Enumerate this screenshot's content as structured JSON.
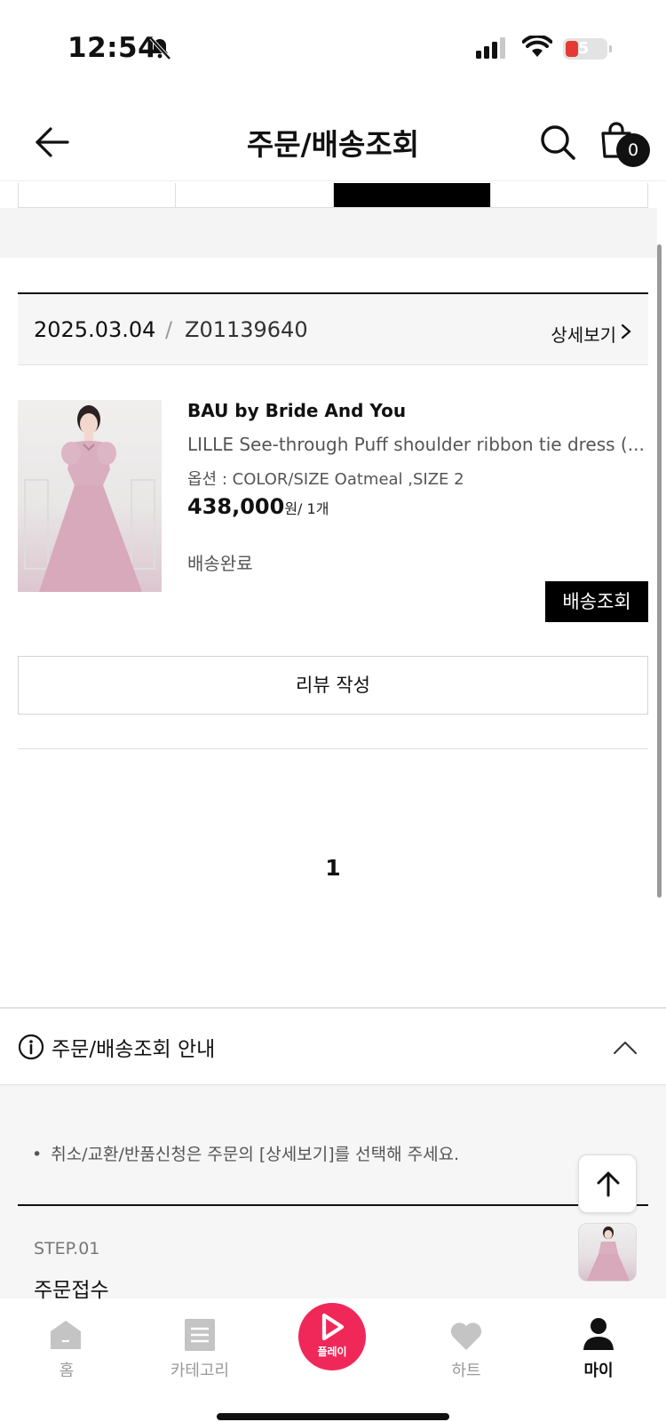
{
  "status_bar": {
    "time": "12:54",
    "battery": "5",
    "icons": [
      "bell-muted-icon",
      "signal-icon",
      "wifi-icon",
      "battery-icon"
    ]
  },
  "header": {
    "title": "주문/배송조회",
    "cart_count": "0",
    "icons": [
      "back-arrow-icon",
      "search-icon",
      "shopping-bag-icon"
    ]
  },
  "order": {
    "date": "2025.03.04",
    "separator": "/",
    "order_number": "Z01139640",
    "detail_label": "상세보기",
    "item": {
      "brand": "BAU by Bride And You",
      "name": "LILLE See-through Puff shoulder ribbon tie dress (...",
      "option": "옵션 : COLOR/SIZE Oatmeal ,SIZE 2",
      "price": "438,000",
      "price_unit": "원/ 1개",
      "status": "배송완료",
      "track_button": "배송조회"
    },
    "review_button": "리뷰 작성"
  },
  "pagination": {
    "current": "1"
  },
  "guide": {
    "title": "주문/배송조회 안내",
    "notice": "취소/교환/반품신청은 주문의 [상세보기]를 선택해 주세요.",
    "step_label": "STEP.01",
    "step_name": "주문접수"
  },
  "bottom_nav": {
    "home": "홈",
    "category": "카테고리",
    "play": "플레이",
    "heart": "하트",
    "my": "마이",
    "active": "my"
  },
  "colors": {
    "accent": "#f0285a",
    "primary": "#000000",
    "inactive_nav": "#9a9a9a",
    "battery_low": "#e53935"
  }
}
